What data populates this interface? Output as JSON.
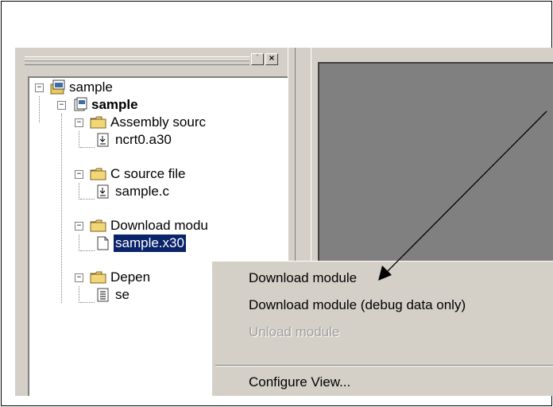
{
  "window_controls": {
    "minimize_glyph": "˅",
    "close_glyph": "×"
  },
  "tree": {
    "nodes": [
      {
        "label": "sample",
        "icon": "workspace-icon"
      },
      {
        "label": "sample",
        "icon": "project-icon",
        "bold": true
      },
      {
        "label": "Assembly sourc",
        "icon": "folder-icon"
      },
      {
        "label": "ncrt0.a30",
        "icon": "source-file-icon"
      },
      {
        "label": "C source file",
        "icon": "folder-icon"
      },
      {
        "label": "sample.c",
        "icon": "source-file-icon"
      },
      {
        "label": "Download modu",
        "icon": "folder-icon"
      },
      {
        "label": "sample.x30",
        "icon": "file-icon",
        "selected": true
      },
      {
        "label": "Depen",
        "icon": "folder-icon"
      },
      {
        "label": "se",
        "icon": "dependency-file-icon"
      }
    ]
  },
  "context_menu": {
    "items": [
      {
        "label": "Download module",
        "enabled": true
      },
      {
        "label": "Download module (debug data only)",
        "enabled": true
      },
      {
        "label": "Unload module",
        "enabled": false
      },
      {
        "label": "Configure View...",
        "enabled": true
      }
    ]
  },
  "colors": {
    "selection": "#0a246a",
    "face": "#d4d0c8",
    "workspace_gray": "#808080"
  }
}
